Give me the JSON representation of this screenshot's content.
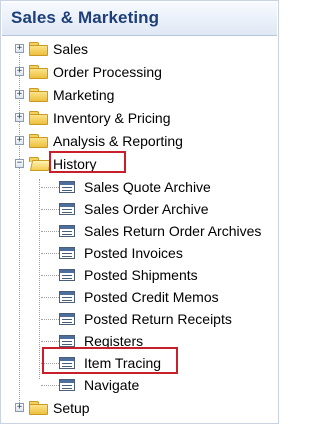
{
  "panel": {
    "title": "Sales & Marketing"
  },
  "tree": {
    "expander_collapsed": "+",
    "expander_expanded": "−",
    "groups": [
      {
        "label": "Sales",
        "state": "collapsed"
      },
      {
        "label": "Order Processing",
        "state": "collapsed"
      },
      {
        "label": "Marketing",
        "state": "collapsed"
      },
      {
        "label": "Inventory & Pricing",
        "state": "collapsed"
      },
      {
        "label": "Analysis & Reporting",
        "state": "collapsed"
      },
      {
        "label": "History",
        "state": "expanded",
        "highlighted": true
      },
      {
        "label": "Setup",
        "state": "collapsed"
      }
    ],
    "history_items": [
      {
        "label": "Sales Quote Archive"
      },
      {
        "label": "Sales Order Archive"
      },
      {
        "label": "Sales Return Order Archives"
      },
      {
        "label": "Posted Invoices"
      },
      {
        "label": "Posted Shipments"
      },
      {
        "label": "Posted Credit Memos"
      },
      {
        "label": "Posted Return Receipts"
      },
      {
        "label": "Registers"
      },
      {
        "label": "Item Tracing",
        "highlighted": true
      },
      {
        "label": "Navigate"
      }
    ]
  },
  "colors": {
    "title": "#1e3f7a",
    "highlight": "#c8202a",
    "folder": "#f6d15e"
  },
  "icons": {
    "group": "folder-icon",
    "group_open": "open-folder-icon",
    "item": "list-page-icon"
  }
}
